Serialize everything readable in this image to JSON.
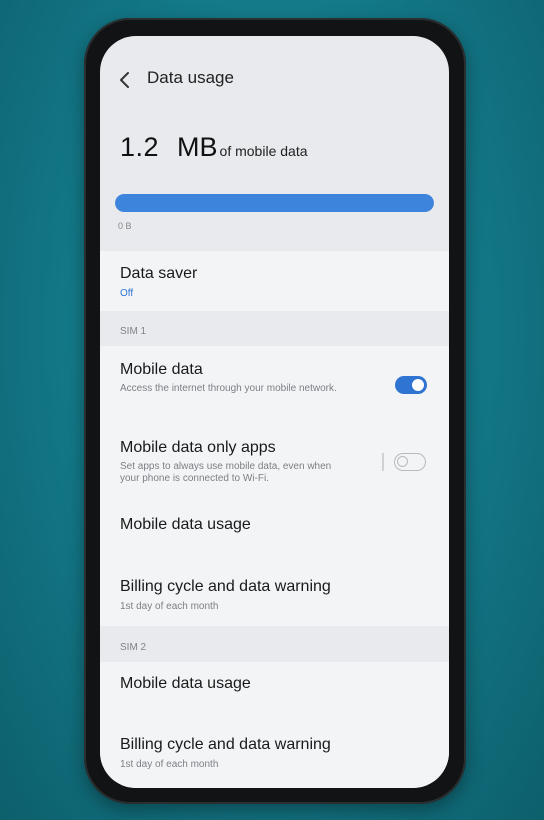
{
  "header": {
    "title": "Data usage"
  },
  "usage": {
    "amount": "1.2",
    "unit": "MB",
    "suffix": "of mobile data",
    "bar_fill_fraction": 1.0,
    "bar_min_label": "0 B"
  },
  "data_saver": {
    "title": "Data saver",
    "status": "Off"
  },
  "sim1": {
    "label": "SIM 1",
    "mobile_data": {
      "title": "Mobile data",
      "description": "Access the internet through your mobile network.",
      "enabled": true
    },
    "only_apps": {
      "title": "Mobile data only apps",
      "description": "Set apps to always use mobile data, even when your phone is connected to Wi-Fi.",
      "enabled": false
    },
    "usage": {
      "title": "Mobile data usage"
    },
    "billing": {
      "title": "Billing cycle and data warning",
      "detail": "1st day of each month"
    }
  },
  "sim2": {
    "label": "SIM 2",
    "usage": {
      "title": "Mobile data usage"
    },
    "billing": {
      "title": "Billing cycle and data warning",
      "detail": "1st day of each month"
    }
  },
  "colors": {
    "accent": "#2f74d0",
    "bar": "#3d84dc",
    "background": "#137786"
  }
}
